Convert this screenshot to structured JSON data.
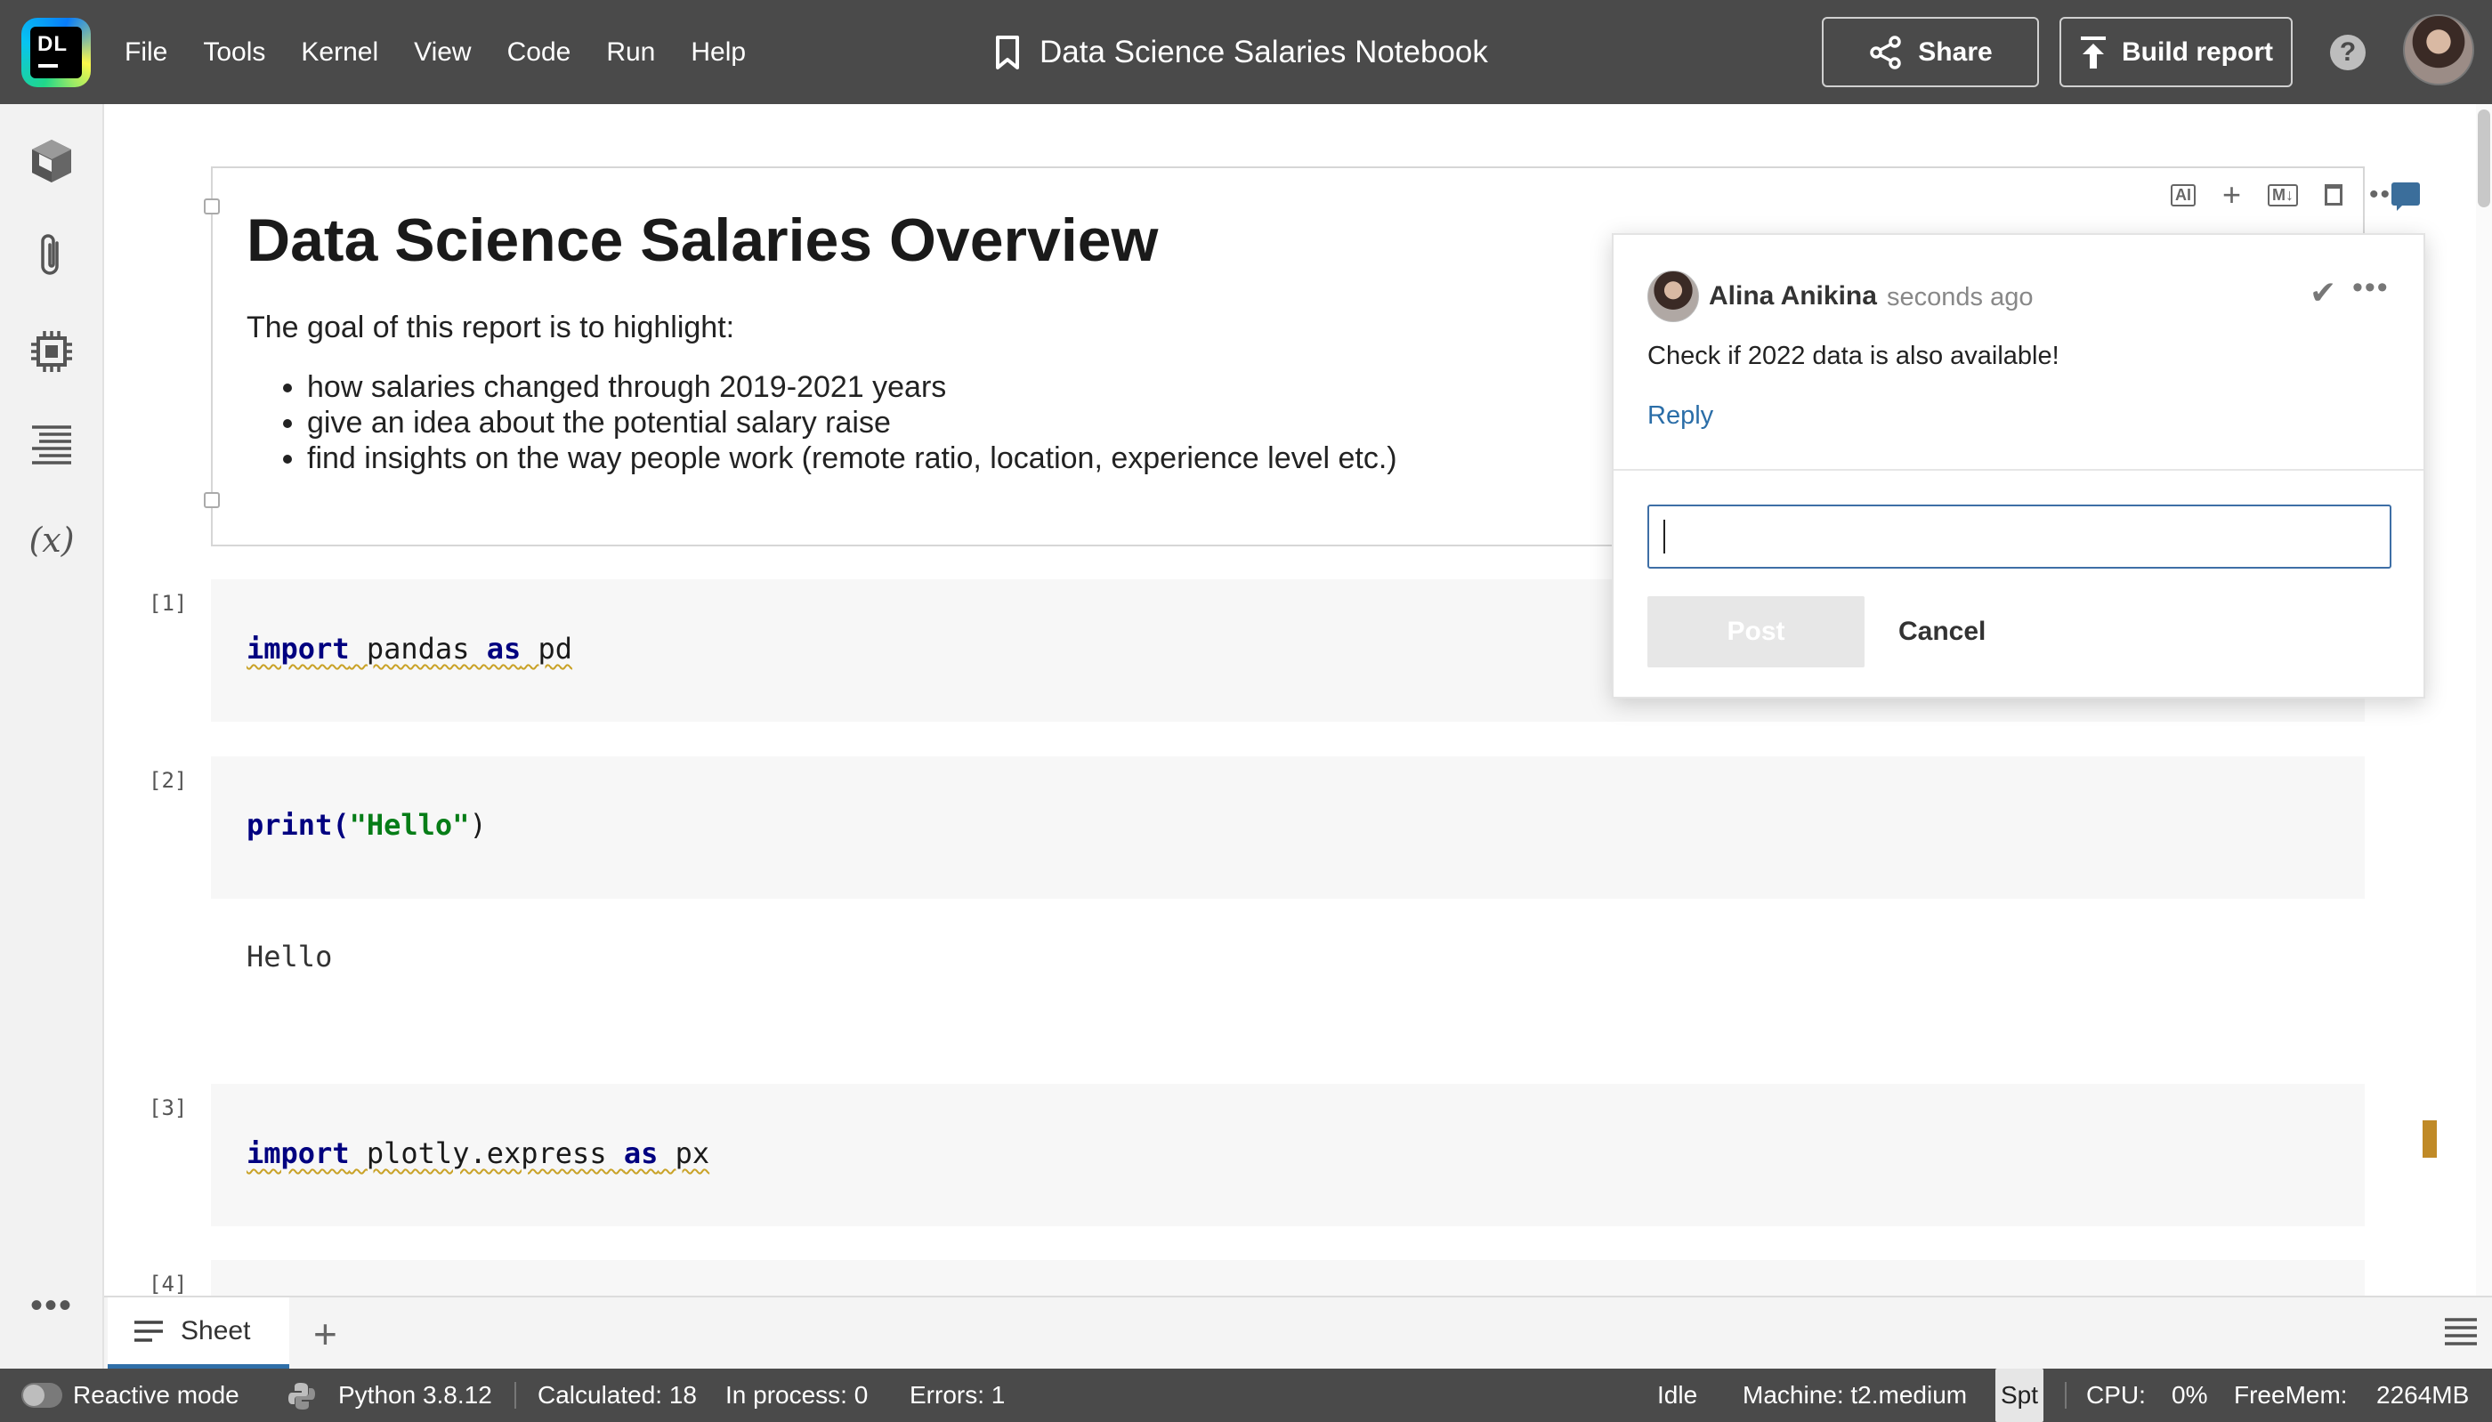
{
  "app": {
    "logo_text": "DL",
    "notebook_title": "Data Science Salaries Notebook",
    "menu": [
      "File",
      "Tools",
      "Kernel",
      "View",
      "Code",
      "Run",
      "Help"
    ],
    "share_label": "Share",
    "build_report_label": "Build report",
    "help_label": "?"
  },
  "markdown_cell": {
    "heading": "Data Science Salaries Overview",
    "intro": "The goal of this report is to highlight:",
    "bullets": [
      "how salaries changed through 2019-2021 years",
      "give an idea about the potential salary raise",
      "find insights on the way people work (remote ratio, location, experience level etc.)"
    ],
    "toolbar": {
      "ai_label": "AI",
      "add_label": "+",
      "md_label": "M↓"
    }
  },
  "code_cells": [
    {
      "number": "[1]",
      "tokens": {
        "kw1": "import",
        "mid": " pandas ",
        "kw2": "as",
        "tail": " pd"
      }
    },
    {
      "number": "[2]",
      "tokens": {
        "fn": "print(",
        "str": "\"Hello\"",
        "close": ")"
      },
      "output": "Hello"
    },
    {
      "number": "[3]",
      "tokens": {
        "kw1": "import",
        "mid": " plotly.express ",
        "kw2": "as",
        "tail": " px"
      }
    },
    {
      "number": "[4]"
    }
  ],
  "comment": {
    "author": "Alina Anikina",
    "time": "seconds ago",
    "text": "Check if 2022 data is also available!",
    "reply_label": "Reply",
    "input_value": "",
    "post_label": "Post",
    "cancel_label": "Cancel"
  },
  "tabs": {
    "sheet_label": "Sheet",
    "add_label": "+"
  },
  "status": {
    "reactive_mode": "Reactive mode",
    "python": "Python 3.8.12",
    "calculated": "Calculated: 18",
    "in_process": "In process: 0",
    "errors": "Errors: 1",
    "state": "Idle",
    "machine": "Machine: t2.medium",
    "spot": "Spt",
    "cpu_label": "CPU:",
    "cpu_value": "0%",
    "freemem_label": "FreeMem:",
    "freemem_value": "2264MB"
  },
  "colors": {
    "topbar": "#4a4a4a",
    "accent": "#2f6fa8",
    "marker": "#c08a27"
  }
}
